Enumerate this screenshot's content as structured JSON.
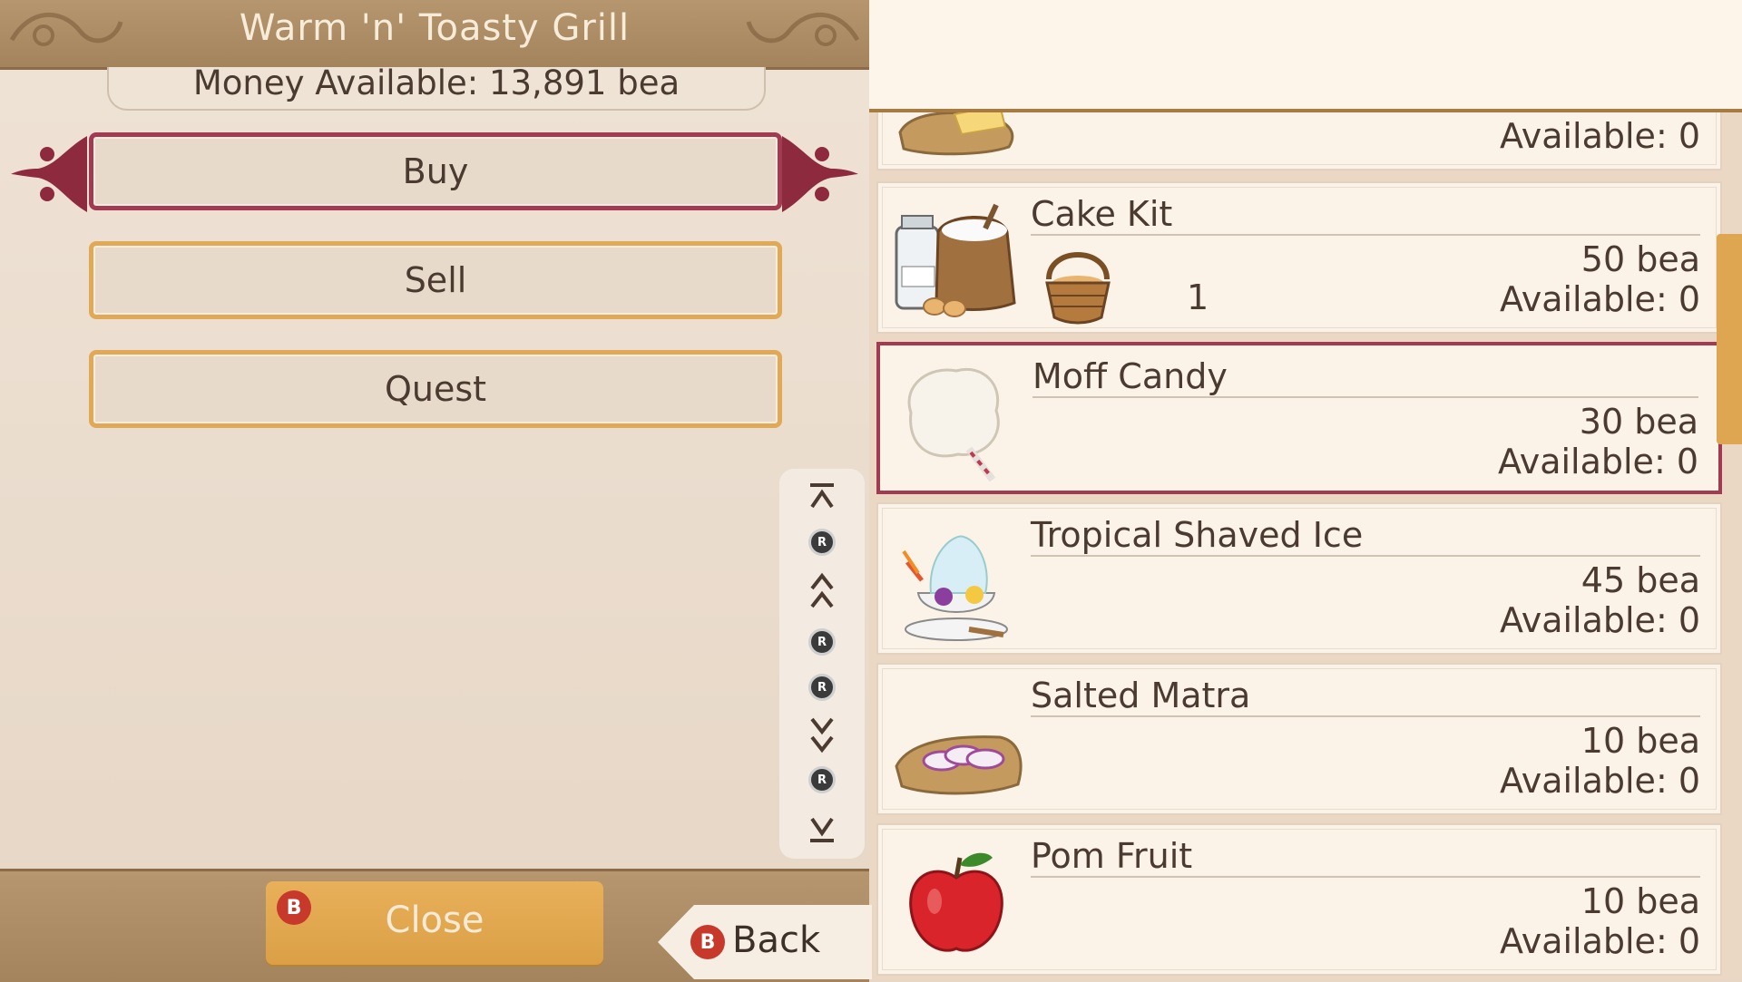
{
  "shop": {
    "name": "Warm 'n' Toasty Grill",
    "money_label": "Money Available: 13,891 bea"
  },
  "menu": {
    "buy": "Buy",
    "sell": "Sell",
    "quest": "Quest",
    "selected": "Buy"
  },
  "scroll_guide": {
    "button_letter": "R"
  },
  "footer": {
    "close_label": "Close",
    "close_button_letter": "B",
    "back_label": "Back",
    "back_button_letter": "B"
  },
  "items": [
    {
      "name": "",
      "price": "",
      "available": "Available: 0",
      "icon": "cheese-bread-icon"
    },
    {
      "name": "Cake Kit",
      "price": "50 bea",
      "available": "Available: 0",
      "quantity": "1",
      "icon": "cake-kit-icon"
    },
    {
      "name": "Moff Candy",
      "price": "30 bea",
      "available": "Available: 0",
      "icon": "cotton-candy-icon",
      "selected": true
    },
    {
      "name": "Tropical Shaved Ice",
      "price": "45 bea",
      "available": "Available: 0",
      "icon": "shaved-ice-icon"
    },
    {
      "name": "Salted Matra",
      "price": "10 bea",
      "available": "Available: 0",
      "icon": "salted-fish-icon"
    },
    {
      "name": "Pom Fruit",
      "price": "10 bea",
      "available": "Available: 0",
      "icon": "apple-icon"
    }
  ],
  "colors": {
    "accent_selected": "#a23a52",
    "accent_orange": "#e0a955",
    "header_brown": "#a3845d",
    "badge_red": "#c6392b"
  }
}
